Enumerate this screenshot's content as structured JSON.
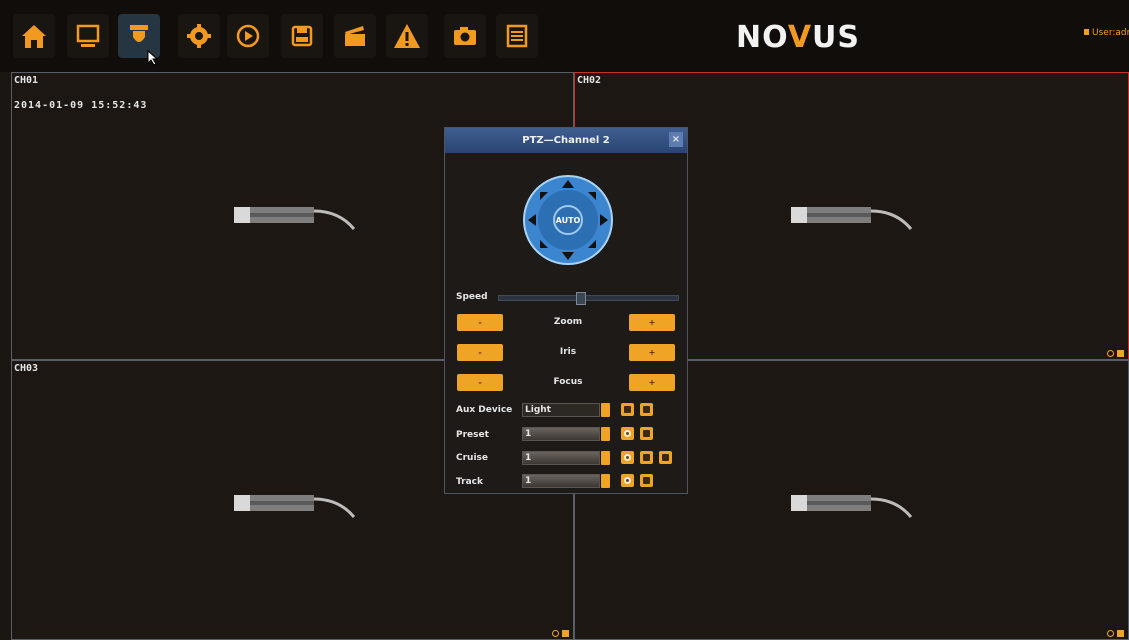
{
  "toolbar": {
    "buttons": [
      {
        "name": "home-icon",
        "active": false
      },
      {
        "name": "monitor-icon",
        "active": false
      },
      {
        "name": "ptz-camera-icon",
        "active": true
      },
      {
        "name": "gear-icon",
        "active": false
      },
      {
        "name": "playback-icon",
        "active": false
      },
      {
        "name": "save-icon",
        "active": false
      },
      {
        "name": "clapperboard-icon",
        "active": false
      },
      {
        "name": "warning-icon",
        "active": false
      },
      {
        "name": "snapshot-icon",
        "active": false
      },
      {
        "name": "list-icon",
        "active": false
      }
    ],
    "logo_prefix": "NO",
    "logo_v": "V",
    "logo_suffix": "US",
    "user_label": "User:admin"
  },
  "channels": {
    "ch1": {
      "label": "CH01",
      "timestamp": "2014-01-09 15:52:43"
    },
    "ch2": {
      "label": "CH02"
    },
    "ch3": {
      "label": "CH03"
    }
  },
  "ptz": {
    "title": "PTZ—Channel 2",
    "close": "×",
    "auto_label": "AUTO",
    "speed_label": "Speed",
    "speed_level": 0.45,
    "zoom_label": "Zoom",
    "iris_label": "Iris",
    "focus_label": "Focus",
    "minus": "-",
    "plus": "+",
    "aux_label": "Aux Device",
    "aux_value": "Light",
    "preset_label": "Preset",
    "preset_value": "1",
    "cruise_label": "Cruise",
    "cruise_value": "1",
    "track_label": "Track",
    "track_value": "1"
  },
  "colors": {
    "accent": "#f0a426",
    "selected_border": "#c9322b",
    "title_bar": "#3f5e90"
  }
}
